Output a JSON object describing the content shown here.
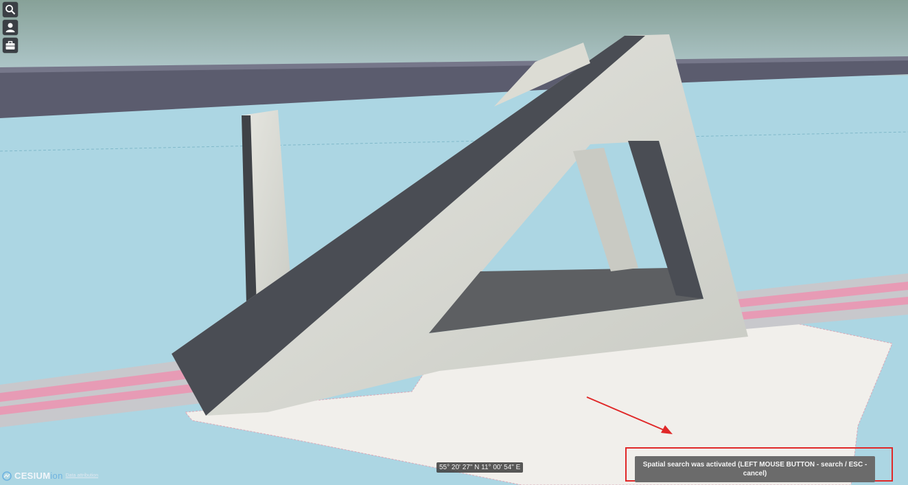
{
  "toolbar": {
    "items": [
      {
        "icon": "search-icon"
      },
      {
        "icon": "user-icon"
      },
      {
        "icon": "briefcase-icon"
      }
    ]
  },
  "status": {
    "coordinates": "55° 20' 27\" N 11° 00' 54\" E"
  },
  "notification": {
    "message": "Spatial search was activated (LEFT MOUSE BUTTON - search / ESC - cancel)"
  },
  "credits": {
    "logo_primary": "CESIUM",
    "logo_secondary": "ion",
    "attribution_link": "Data attribution"
  },
  "colors": {
    "annotation_red": "#e02828",
    "toolbar_bg": "#3b3f45",
    "toast_bg": "#6b6b6b",
    "water": "#a9d3e0"
  }
}
